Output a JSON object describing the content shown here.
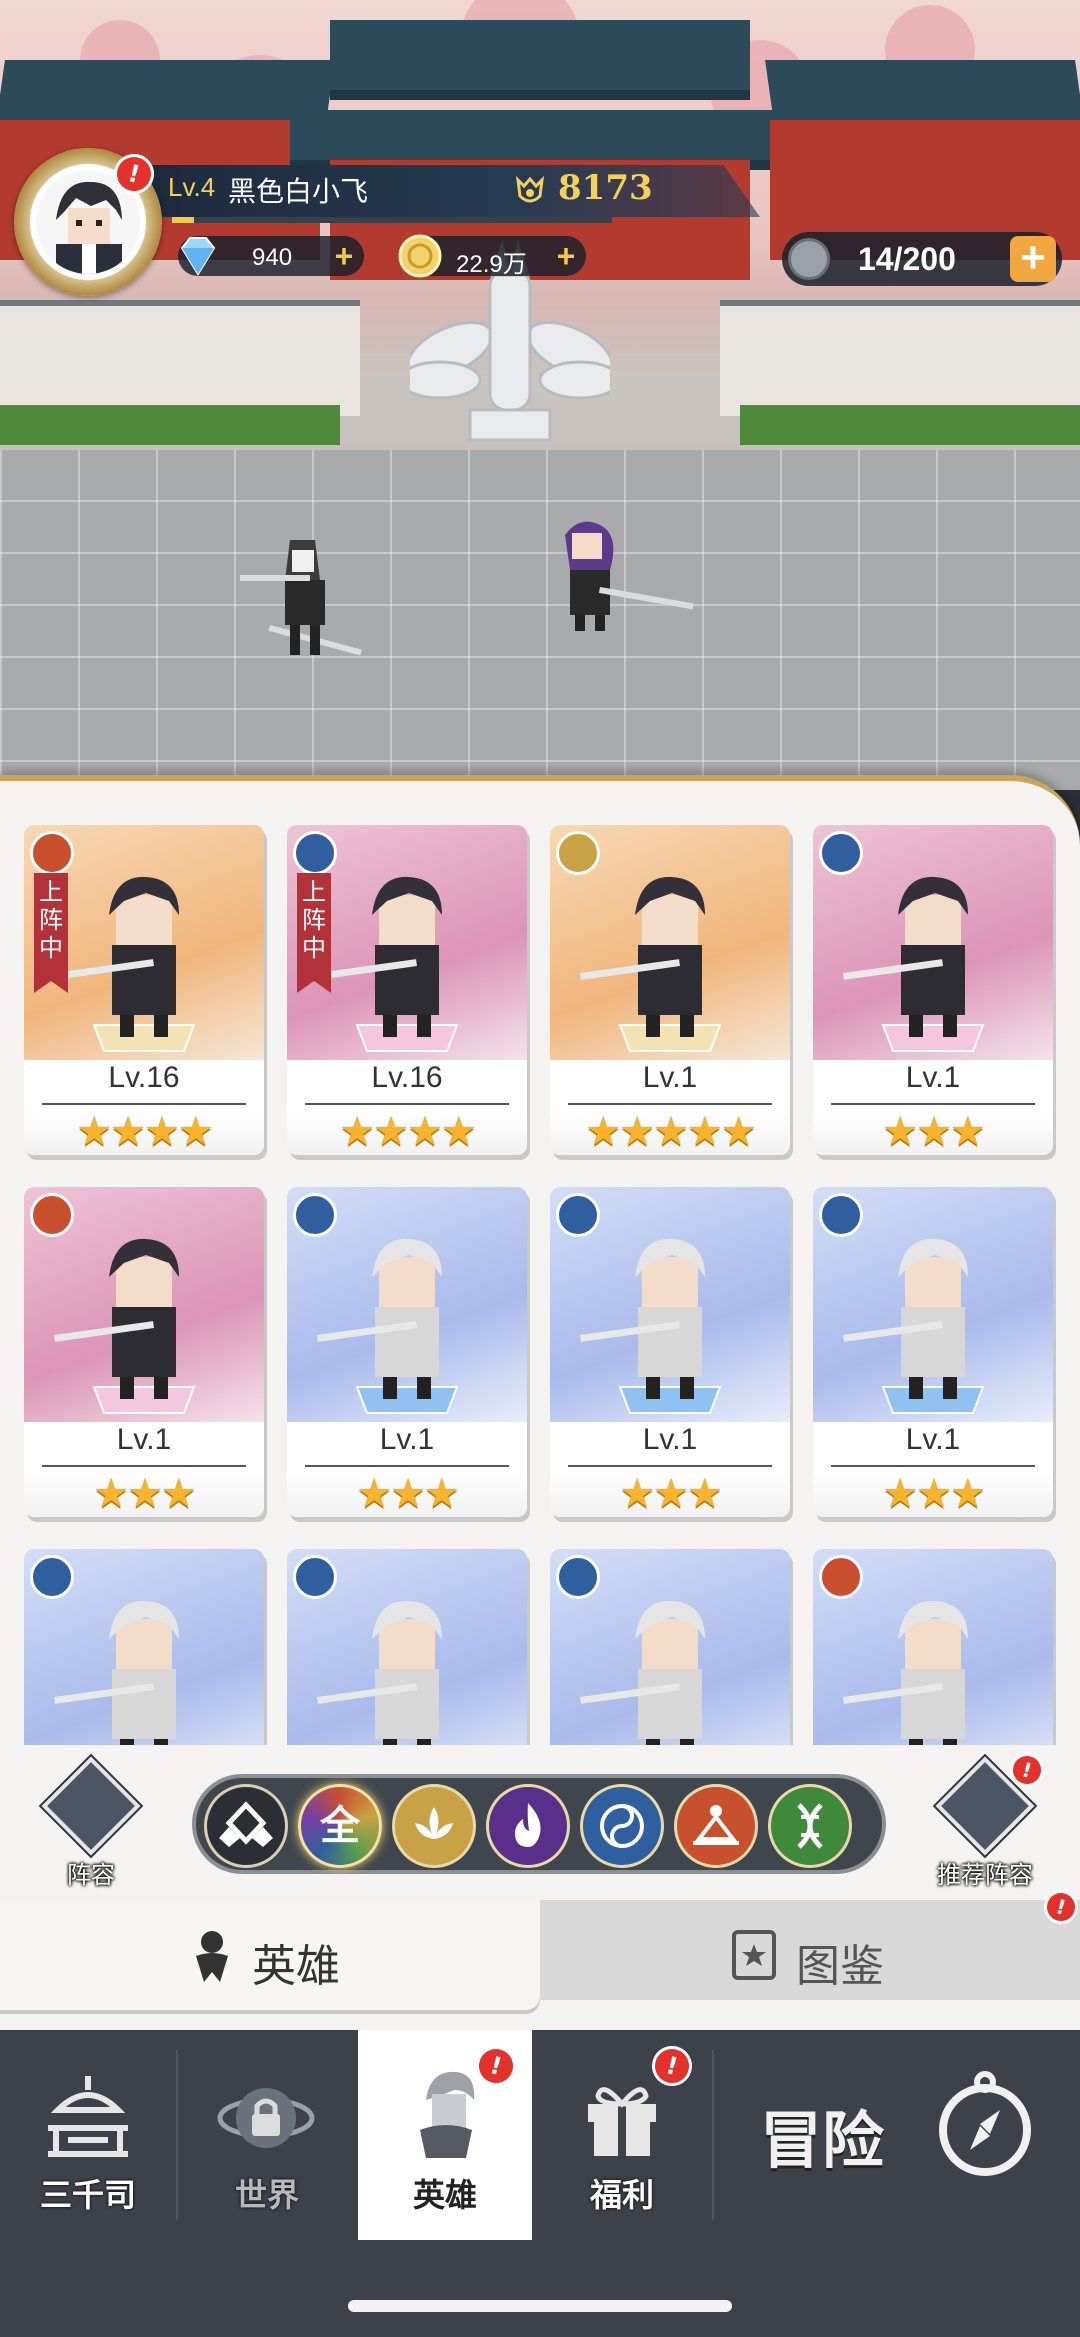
{
  "player": {
    "level": "Lv.4",
    "name": "黑色白小飞",
    "power": "8173",
    "xp_fraction": 0.05
  },
  "currencies": {
    "diamonds": "940",
    "gold": "22.9万",
    "stamina": "14/200"
  },
  "icons": {
    "add": "+",
    "alert": "!"
  },
  "heroes": [
    {
      "level": "Lv.16",
      "stars": "★★★★",
      "deployed": "上阵中",
      "faction": "orange",
      "bg": "orange"
    },
    {
      "level": "Lv.16",
      "stars": "★★★★",
      "deployed": "上阵中",
      "faction": "blue",
      "bg": "pink"
    },
    {
      "level": "Lv.1",
      "stars": "★★★★★",
      "deployed": "",
      "faction": "gold",
      "bg": "orange"
    },
    {
      "level": "Lv.1",
      "stars": "★★★",
      "deployed": "",
      "faction": "blue",
      "bg": "pink"
    },
    {
      "level": "Lv.1",
      "stars": "★★★",
      "deployed": "",
      "faction": "orange",
      "bg": "pink"
    },
    {
      "level": "Lv.1",
      "stars": "★★★",
      "deployed": "",
      "faction": "blue",
      "bg": "blue"
    },
    {
      "level": "Lv.1",
      "stars": "★★★",
      "deployed": "",
      "faction": "blue",
      "bg": "blue"
    },
    {
      "level": "Lv.1",
      "stars": "★★★",
      "deployed": "",
      "faction": "blue",
      "bg": "blue"
    },
    {
      "level": "",
      "stars": "",
      "deployed": "",
      "faction": "blue",
      "bg": "blue"
    },
    {
      "level": "",
      "stars": "",
      "deployed": "",
      "faction": "blue",
      "bg": "blue"
    },
    {
      "level": "",
      "stars": "",
      "deployed": "",
      "faction": "blue",
      "bg": "blue"
    },
    {
      "level": "",
      "stars": "",
      "deployed": "",
      "faction": "orange",
      "bg": "blue"
    }
  ],
  "filters": {
    "lineup_label": "阵容",
    "all_label": "全",
    "recommended_label": "推荐阵容"
  },
  "tabs": {
    "heroes": "英雄",
    "codex": "图鉴"
  },
  "nav": {
    "sanqiansi": "三千司",
    "world": "世界",
    "heroes": "英雄",
    "benefits": "福利",
    "adventure": "冒险"
  },
  "colors": {
    "accent_gold": "#f3cf5c",
    "alert_red": "#e2322b",
    "bg_orange": "#f5c58e",
    "bg_pink": "#e7a9c6",
    "bg_blue": "#b8c8ef",
    "faction_orange": "#c8502f",
    "faction_blue": "#2f5f9e",
    "faction_gold": "#c9a245"
  }
}
